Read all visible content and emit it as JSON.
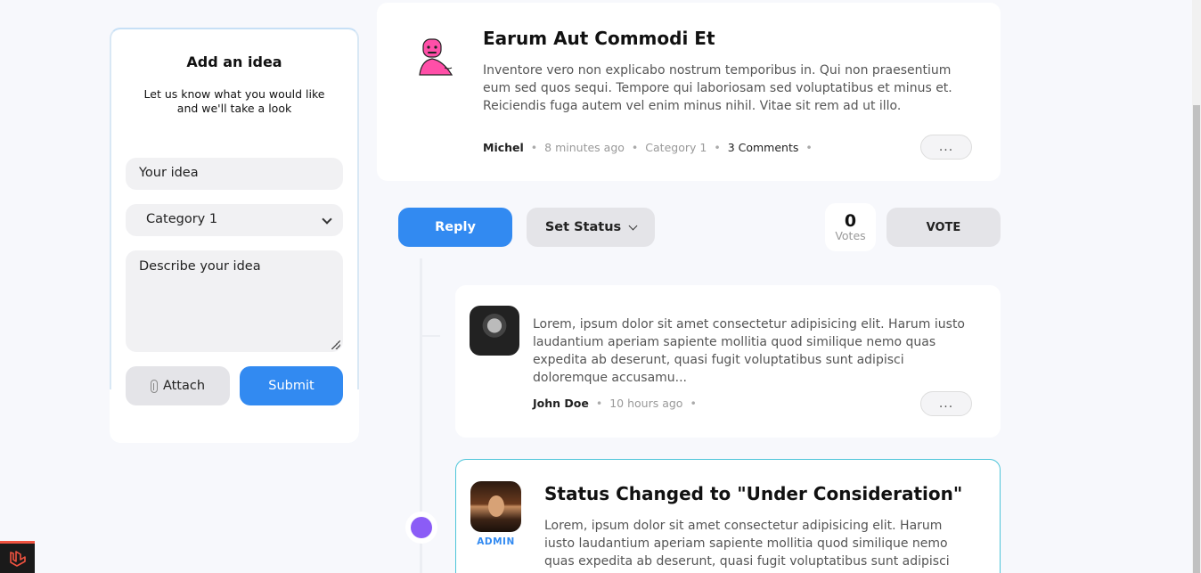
{
  "add_idea": {
    "title": "Add an idea",
    "subtitle": "Let us know what you would like and we'll take a look",
    "idea_placeholder": "Your idea",
    "category_selected": "Category 1",
    "description_placeholder": "Describe your idea",
    "attach_label": "Attach",
    "submit_label": "Submit"
  },
  "idea": {
    "title": "Earum Aut Commodi Et",
    "description": "Inventore vero non explicabo nostrum temporibus in. Qui non praesentium eum sed quos sequi. Tempore qui laboriosam sed voluptatibus et minus et. Reiciendis fuga autem vel enim minus nihil. Vitae sit rem ad ut illo.",
    "author": "Michel",
    "time": "8 minutes ago",
    "category": "Category 1",
    "comments": "3 Comments",
    "more_label": "..."
  },
  "actions": {
    "reply_label": "Reply",
    "set_status_label": "Set Status",
    "votes_count": "0",
    "votes_label": "Votes",
    "vote_label": "VOTE"
  },
  "comments": [
    {
      "text": "Lorem, ipsum dolor sit amet consectetur adipisicing elit. Harum iusto laudantium aperiam sapiente mollitia quod similique nemo quas expedita ab deserunt, quasi fugit voluptatibus sunt adipisci doloremque accusamu...",
      "author": "John Doe",
      "time": "10 hours ago",
      "more_label": "..."
    }
  ],
  "status_update": {
    "badge": "ADMIN",
    "title": "Status Changed to \"Under Consideration\"",
    "text": "Lorem, ipsum dolor sit amet consectetur adipisicing elit. Harum iusto laudantium aperiam sapiente mollitia quod similique nemo quas expedita ab deserunt, quasi fugit voluptatibus sunt adipisci doloremqu..."
  },
  "colors": {
    "primary": "#328af1",
    "timeline_dot": "#8b5cf6",
    "status_border": "#4ec5d9",
    "laravel": "#f05340"
  }
}
